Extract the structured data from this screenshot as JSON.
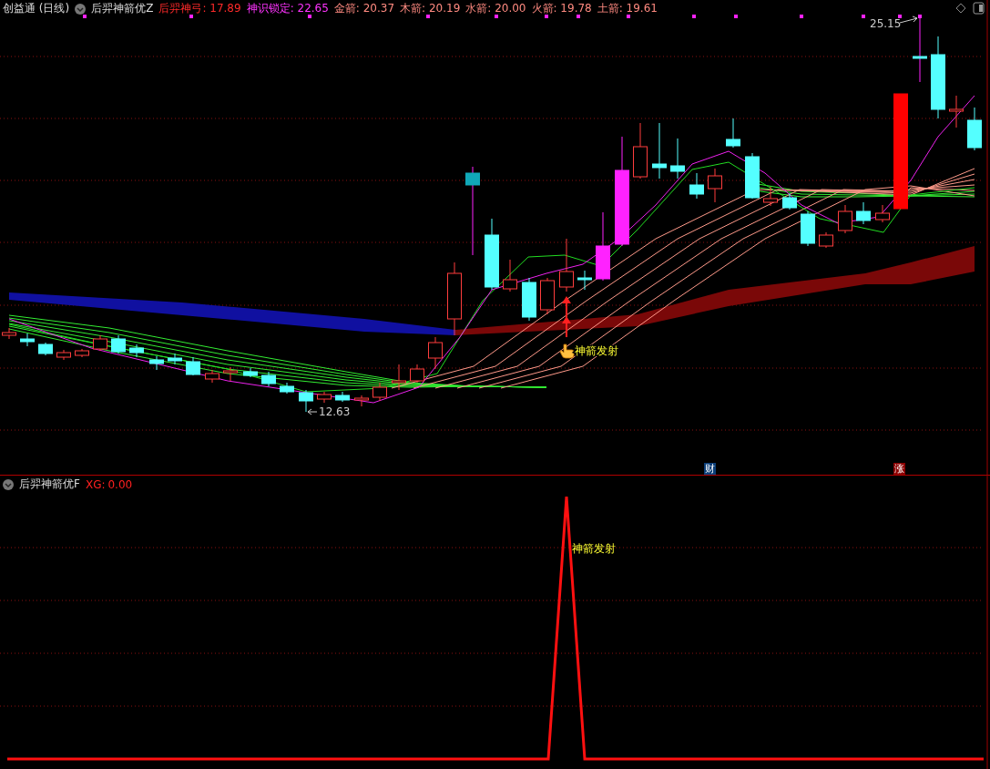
{
  "main_panel": {
    "title": "创益通 (日线)",
    "indicator": "后羿神箭优Z",
    "legend": [
      {
        "text": "后羿神弓: 17.89",
        "color": "#ff2a2a"
      },
      {
        "text": "神识锁定: 22.65",
        "color": "#ff33ff"
      },
      {
        "text": "金箭: 20.37",
        "color": "#ff8a80"
      },
      {
        "text": "木箭: 20.19",
        "color": "#ff8a80"
      },
      {
        "text": "水箭: 20.00",
        "color": "#ff8a80"
      },
      {
        "text": "火箭: 19.78",
        "color": "#ff8a80"
      },
      {
        "text": "土箭: 19.61",
        "color": "#ff8a80"
      }
    ],
    "high_label": "25.15",
    "low_label": "12.63",
    "signal_label": "神箭发射",
    "badges": [
      {
        "text": "财",
        "color": "#0b3e78"
      },
      {
        "text": "涨",
        "color": "#8a0000"
      }
    ]
  },
  "sub_panel": {
    "indicator": "后羿神箭优F",
    "series_name": "XG:",
    "series_value": "0.00",
    "signal_label": "神箭发射"
  }
}
